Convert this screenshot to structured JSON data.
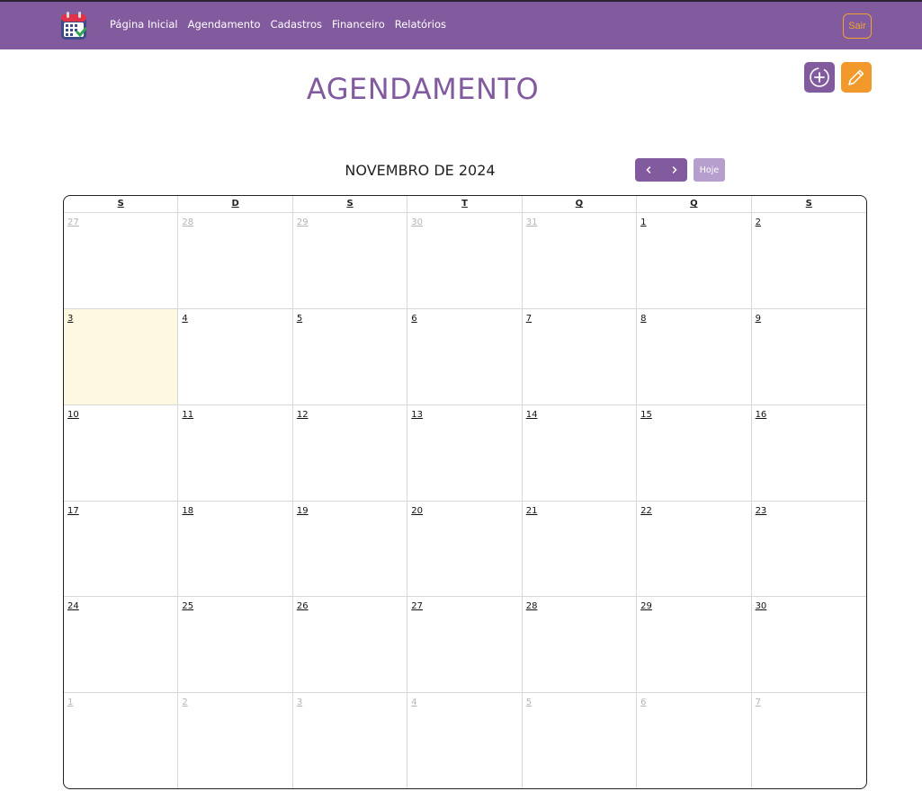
{
  "navbar": {
    "logo_icon": "calendar-check-icon",
    "links": [
      "Página Inicial",
      "Agendamento",
      "Cadastros",
      "Financeiro",
      "Relatórios"
    ],
    "logout_label": "Sair"
  },
  "page": {
    "title": "AGENDAMENTO",
    "add_icon": "circle-plus-icon",
    "edit_icon": "pencil-icon"
  },
  "calendar": {
    "month_title": "NOVEMBRO DE 2024",
    "prev_icon": "chevron-left-icon",
    "next_icon": "chevron-right-icon",
    "today_label": "Hoje",
    "weekdays": [
      "S",
      "D",
      "S",
      "T",
      "Q",
      "Q",
      "S"
    ],
    "weeks": [
      [
        {
          "n": "27",
          "other": true
        },
        {
          "n": "28",
          "other": true
        },
        {
          "n": "29",
          "other": true
        },
        {
          "n": "30",
          "other": true
        },
        {
          "n": "31",
          "other": true
        },
        {
          "n": "1"
        },
        {
          "n": "2"
        }
      ],
      [
        {
          "n": "3",
          "today": true
        },
        {
          "n": "4"
        },
        {
          "n": "5"
        },
        {
          "n": "6"
        },
        {
          "n": "7"
        },
        {
          "n": "8"
        },
        {
          "n": "9"
        }
      ],
      [
        {
          "n": "10"
        },
        {
          "n": "11"
        },
        {
          "n": "12"
        },
        {
          "n": "13"
        },
        {
          "n": "14"
        },
        {
          "n": "15"
        },
        {
          "n": "16"
        }
      ],
      [
        {
          "n": "17"
        },
        {
          "n": "18"
        },
        {
          "n": "19"
        },
        {
          "n": "20"
        },
        {
          "n": "21"
        },
        {
          "n": "22"
        },
        {
          "n": "23"
        }
      ],
      [
        {
          "n": "24"
        },
        {
          "n": "25"
        },
        {
          "n": "26"
        },
        {
          "n": "27"
        },
        {
          "n": "28"
        },
        {
          "n": "29"
        },
        {
          "n": "30"
        }
      ],
      [
        {
          "n": "1",
          "other": true
        },
        {
          "n": "2",
          "other": true
        },
        {
          "n": "3",
          "other": true
        },
        {
          "n": "4",
          "other": true
        },
        {
          "n": "5",
          "other": true
        },
        {
          "n": "6",
          "other": true
        },
        {
          "n": "7",
          "other": true
        }
      ]
    ]
  },
  "colors": {
    "brand_purple": "#825a9e",
    "accent_orange": "#f19a2b",
    "today_highlight": "#fff8e1"
  }
}
